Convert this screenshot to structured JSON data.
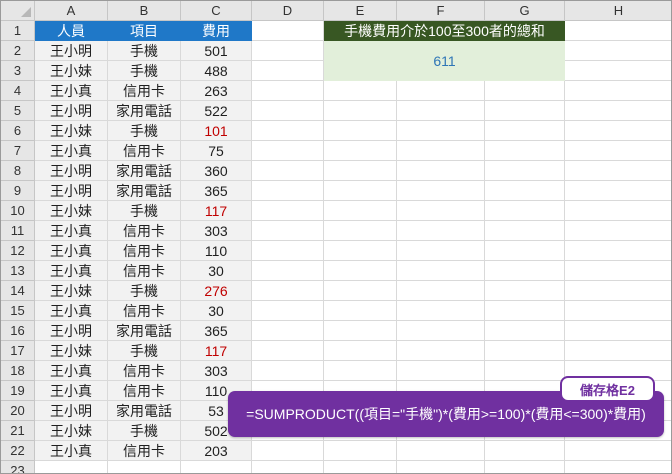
{
  "sheet": {
    "columns": [
      "A",
      "B",
      "C",
      "D",
      "E",
      "F",
      "G",
      "H"
    ],
    "rows": [
      "1",
      "2",
      "3",
      "4",
      "5",
      "6",
      "7",
      "8",
      "9",
      "10",
      "11",
      "12",
      "13",
      "14",
      "15",
      "16",
      "17",
      "18",
      "19",
      "20",
      "21",
      "22",
      "23"
    ],
    "headers": [
      "人員",
      "項目",
      "費用"
    ],
    "data": [
      [
        "王小明",
        "手機",
        "501"
      ],
      [
        "王小妹",
        "手機",
        "488"
      ],
      [
        "王小真",
        "信用卡",
        "263"
      ],
      [
        "王小明",
        "家用電話",
        "522"
      ],
      [
        "王小妹",
        "手機",
        "101"
      ],
      [
        "王小真",
        "信用卡",
        "75"
      ],
      [
        "王小明",
        "家用電話",
        "360"
      ],
      [
        "王小明",
        "家用電話",
        "365"
      ],
      [
        "王小妹",
        "手機",
        "117"
      ],
      [
        "王小真",
        "信用卡",
        "303"
      ],
      [
        "王小真",
        "信用卡",
        "110"
      ],
      [
        "王小真",
        "信用卡",
        "30"
      ],
      [
        "王小妹",
        "手機",
        "276"
      ],
      [
        "王小真",
        "信用卡",
        "30"
      ],
      [
        "王小明",
        "家用電話",
        "365"
      ],
      [
        "王小妹",
        "手機",
        "117"
      ],
      [
        "王小真",
        "信用卡",
        "303"
      ],
      [
        "王小真",
        "信用卡",
        "110"
      ],
      [
        "王小明",
        "家用電話",
        "53"
      ],
      [
        "王小妹",
        "手機",
        "502"
      ],
      [
        "王小真",
        "信用卡",
        "203"
      ]
    ],
    "highlighted_fee_color": "#c00000",
    "summary_title": "手機費用介於100至300者的總和",
    "summary_value": "611"
  },
  "callout": {
    "tag": "儲存格E2",
    "formula": "=SUMPRODUCT((項目=\"手機\")*(費用>=100)*(費用<=300)*費用)"
  },
  "colors": {
    "header_blue": "#1f78c8",
    "title_green": "#385723",
    "result_green": "#e2efda",
    "callout_purple": "#7030a0"
  }
}
